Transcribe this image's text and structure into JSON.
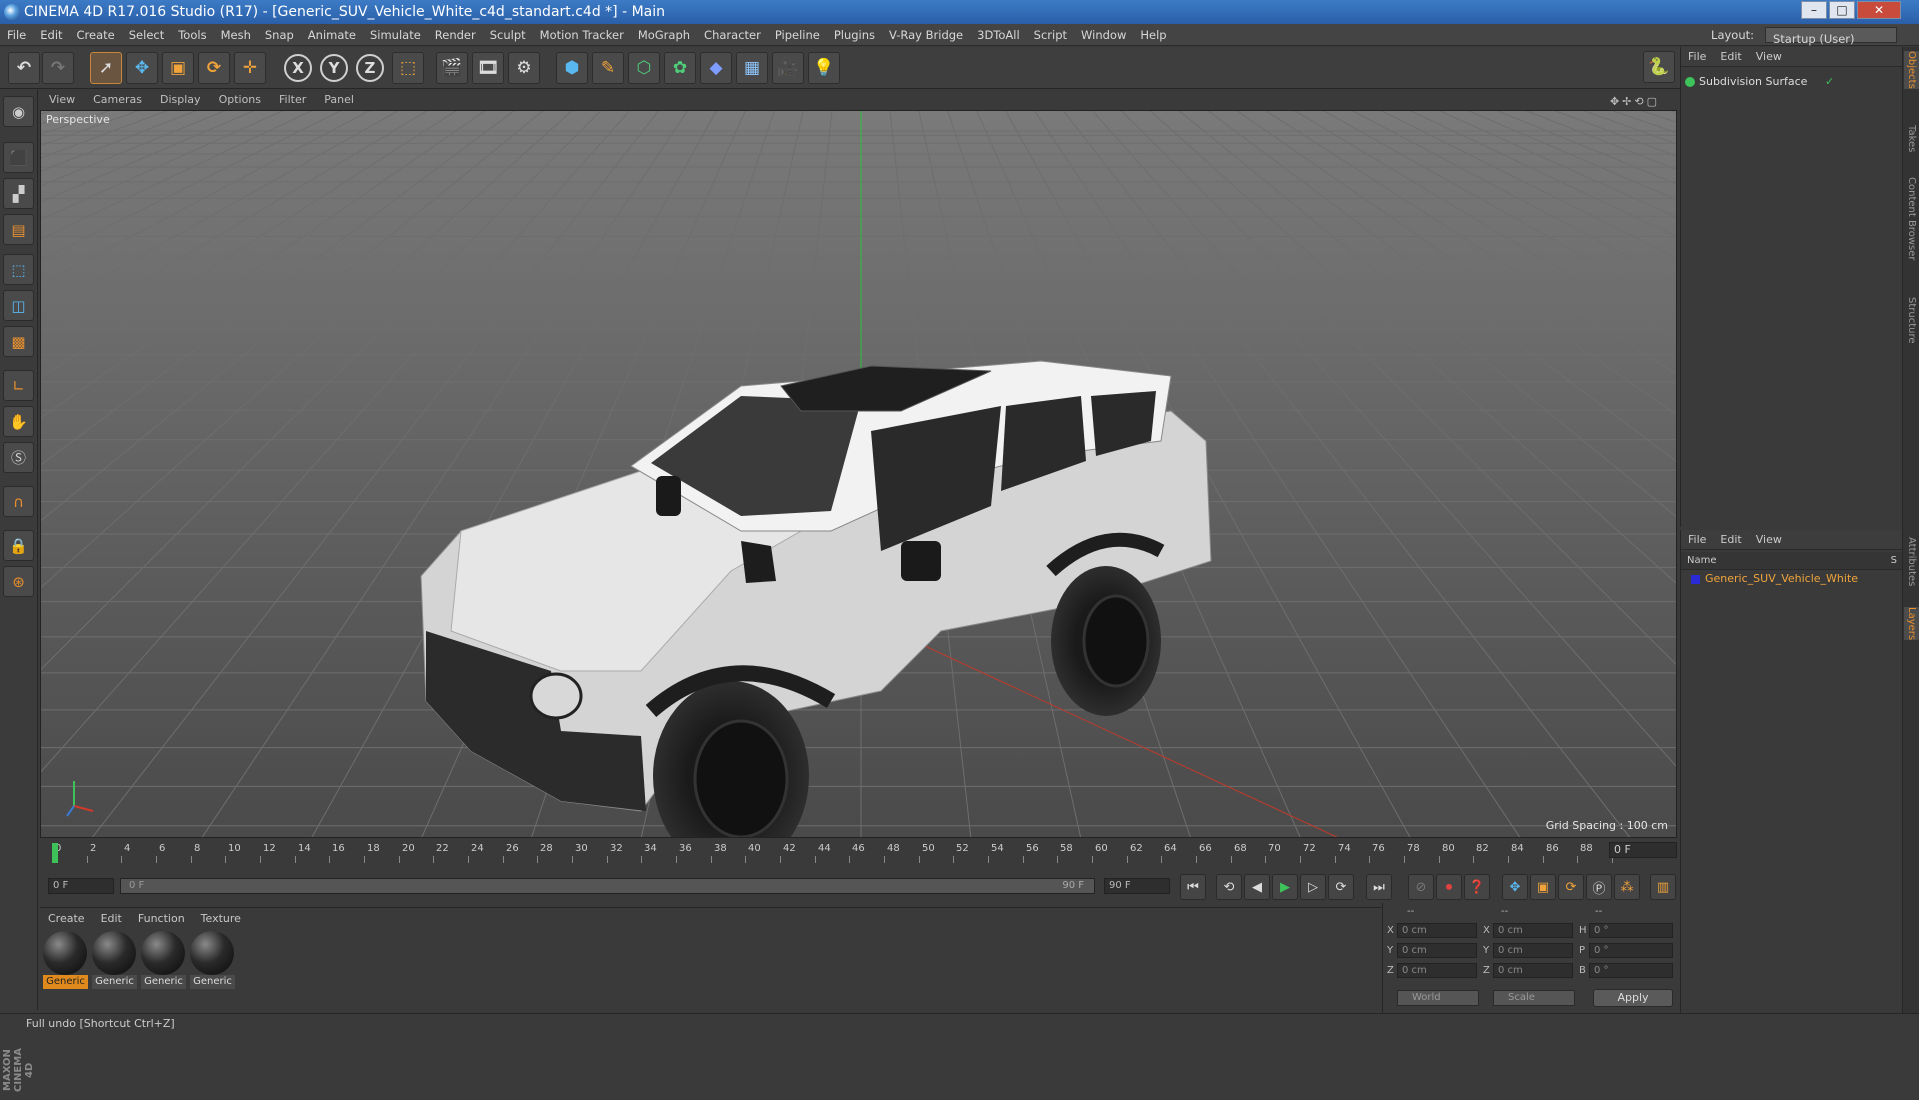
{
  "window": {
    "title": "CINEMA 4D R17.016 Studio (R17) - [Generic_SUV_Vehicle_White_c4d_standart.c4d *] - Main",
    "minimize": "–",
    "maximize": "□",
    "close": "✕"
  },
  "menubar": {
    "items": [
      "File",
      "Edit",
      "Create",
      "Select",
      "Tools",
      "Mesh",
      "Snap",
      "Animate",
      "Simulate",
      "Render",
      "Sculpt",
      "Motion Tracker",
      "MoGraph",
      "Character",
      "Pipeline",
      "Plugins",
      "V-Ray Bridge",
      "3DToAll",
      "Script",
      "Window",
      "Help"
    ],
    "layout_label": "Layout:",
    "layout_value": "Startup (User)"
  },
  "toolbar": {
    "axis_x": "X",
    "axis_y": "Y",
    "axis_z": "Z"
  },
  "viewport": {
    "menu": [
      "View",
      "Cameras",
      "Display",
      "Options",
      "Filter",
      "Panel"
    ],
    "camera_label": "Perspective",
    "grid_spacing": "Grid Spacing : 100 cm"
  },
  "timeline": {
    "ticks": [
      "0",
      "2",
      "4",
      "6",
      "8",
      "10",
      "12",
      "14",
      "16",
      "18",
      "20",
      "22",
      "24",
      "26",
      "28",
      "30",
      "32",
      "34",
      "36",
      "38",
      "40",
      "42",
      "44",
      "46",
      "48",
      "50",
      "52",
      "54",
      "56",
      "58",
      "60",
      "62",
      "64",
      "66",
      "68",
      "70",
      "72",
      "74",
      "76",
      "78",
      "80",
      "82",
      "84",
      "86",
      "88",
      "90"
    ],
    "current_frame": "0 F"
  },
  "transport": {
    "start_field": "0 F",
    "range_start": "0 F",
    "range_end": "90 F",
    "end_field": "90 F"
  },
  "materials": {
    "menu": [
      "Create",
      "Edit",
      "Function",
      "Texture"
    ],
    "items": [
      {
        "label": "Generic",
        "selected": true
      },
      {
        "label": "Generic",
        "selected": false
      },
      {
        "label": "Generic",
        "selected": false
      },
      {
        "label": "Generic",
        "selected": false
      }
    ]
  },
  "coordinates": {
    "header": [
      "--",
      "--",
      "--"
    ],
    "rows": [
      {
        "a": "X",
        "av": "0 cm",
        "b": "X",
        "bv": "0 cm",
        "c": "H",
        "cv": "0 °"
      },
      {
        "a": "Y",
        "av": "0 cm",
        "b": "Y",
        "bv": "0 cm",
        "c": "P",
        "cv": "0 °"
      },
      {
        "a": "Z",
        "av": "0 cm",
        "b": "Z",
        "bv": "0 cm",
        "c": "B",
        "cv": "0 °"
      }
    ],
    "mode": "World",
    "size_mode": "Scale",
    "apply": "Apply"
  },
  "objects": {
    "menu": [
      "File",
      "Edit",
      "View"
    ],
    "items": [
      {
        "name": "Subdivision Surface"
      }
    ]
  },
  "layers": {
    "menu": [
      "File",
      "Edit",
      "View"
    ],
    "header_name": "Name",
    "header_s": "S",
    "items": [
      {
        "name": "Generic_SUV_Vehicle_White"
      }
    ]
  },
  "side_tabs": [
    "Objects",
    "Takes",
    "Content Browser",
    "Structure",
    "Attributes",
    "Layers"
  ],
  "logo": "MAXON CINEMA 4D",
  "status": "Full undo [Shortcut Ctrl+Z]"
}
